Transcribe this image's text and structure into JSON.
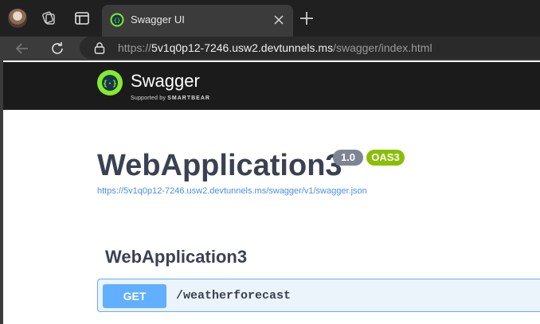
{
  "browser": {
    "tab": {
      "title": "Swagger UI"
    },
    "address": {
      "scheme": "https://",
      "host": "5v1q0p12-7246.usw2.devtunnels.ms",
      "path": "/swagger/index.html"
    }
  },
  "swagger_header": {
    "brand": "Swagger",
    "supported_by": "Supported by",
    "smartbear": "SMARTBEAR"
  },
  "info": {
    "title": "WebApplication3",
    "version": "1.0",
    "oas": "OAS3",
    "spec_url": "https://5v1q0p12-7246.usw2.devtunnels.ms/swagger/v1/swagger.json"
  },
  "operations": {
    "section": "WebApplication3",
    "items": [
      {
        "method": "GET",
        "path": "/weatherforecast"
      }
    ]
  },
  "colors": {
    "get": "#61affe",
    "swagger_green": "#85ea2d",
    "oas": "#89bf04",
    "version": "#7d8492"
  }
}
